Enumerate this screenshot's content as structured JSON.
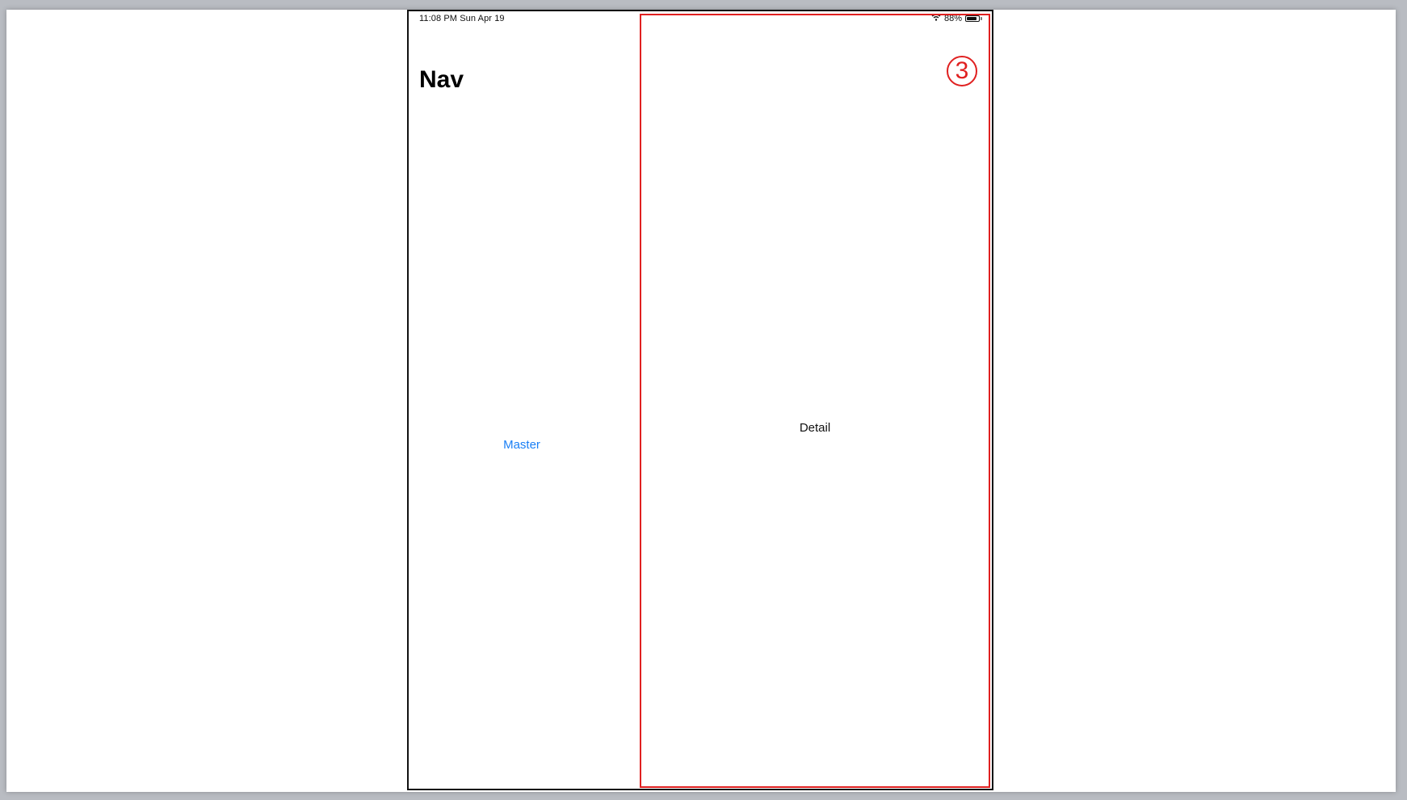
{
  "status_bar": {
    "time": "11:08 PM   Sun Apr 19",
    "battery_percent": "88%",
    "battery_level": 0.88
  },
  "master": {
    "title": "Nav",
    "link_label": "Master"
  },
  "detail": {
    "label": "Detail",
    "callout_number": "3"
  },
  "colors": {
    "accent_blue": "#1a7ff5",
    "annotation_red": "#e02020"
  },
  "icons": [
    "wifi-icon",
    "battery-icon"
  ]
}
